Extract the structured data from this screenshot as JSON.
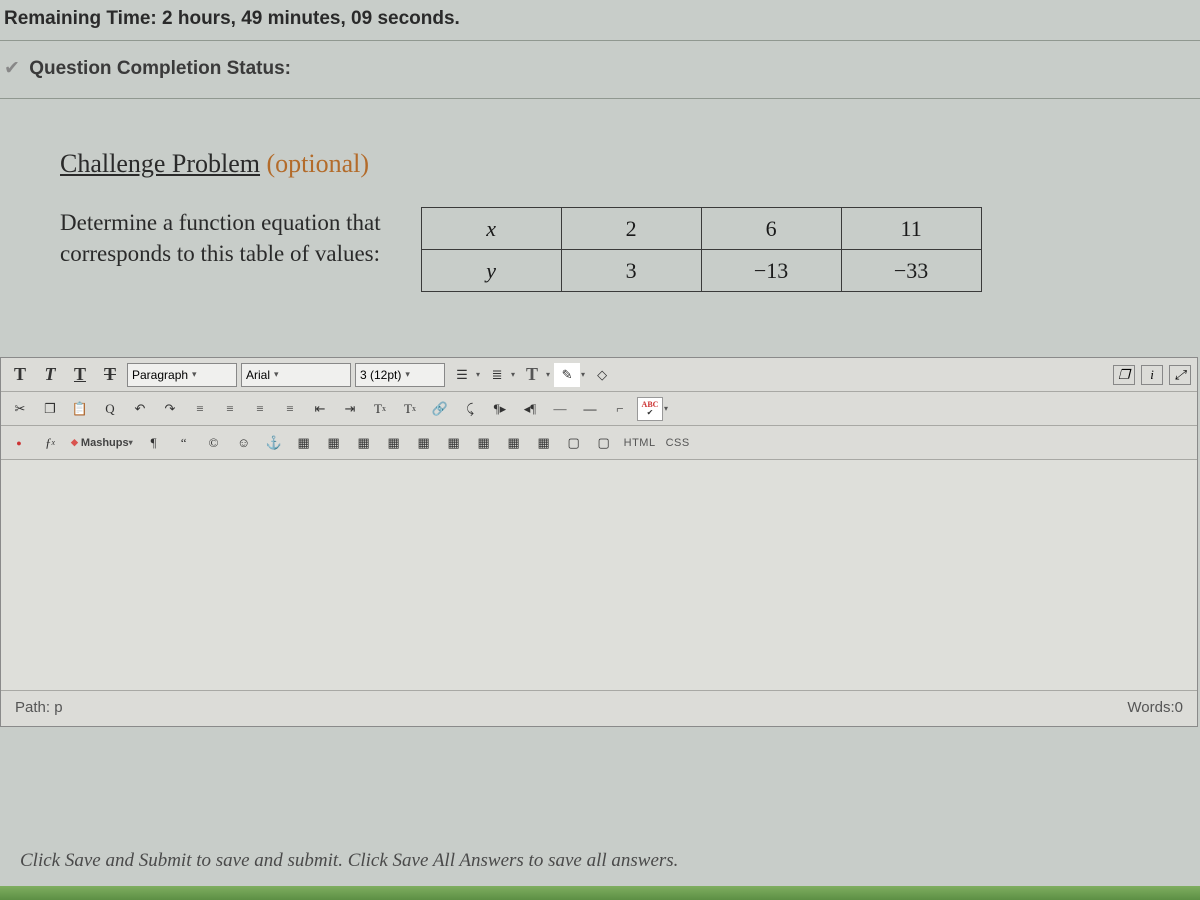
{
  "header": {
    "remaining_label": "Remaining Time:",
    "remaining_value": "2 hours, 49 minutes,",
    "remaining_seconds": "09 seconds.",
    "status_label": "Question Completion Status:"
  },
  "question": {
    "title_main": "Challenge Problem",
    "title_optional": "(optional)",
    "prompt_line1": "Determine a function equation that",
    "prompt_line2": "corresponds to this table of values:",
    "table": {
      "row1": [
        "x",
        "2",
        "6",
        "11"
      ],
      "row2": [
        "y",
        "3",
        "−13",
        "−33"
      ]
    }
  },
  "editor": {
    "format_sel": "Paragraph",
    "font_sel": "Arial",
    "size_sel": "3 (12pt)",
    "mashups": "Mashups",
    "html": "HTML",
    "css": "CSS",
    "path_label": "Path:",
    "path_value": "p",
    "words_label": "Words:0",
    "abc": "ABC"
  },
  "footer": {
    "hint": "Click Save and Submit to save and submit. Click Save All Answers to save all answers."
  }
}
